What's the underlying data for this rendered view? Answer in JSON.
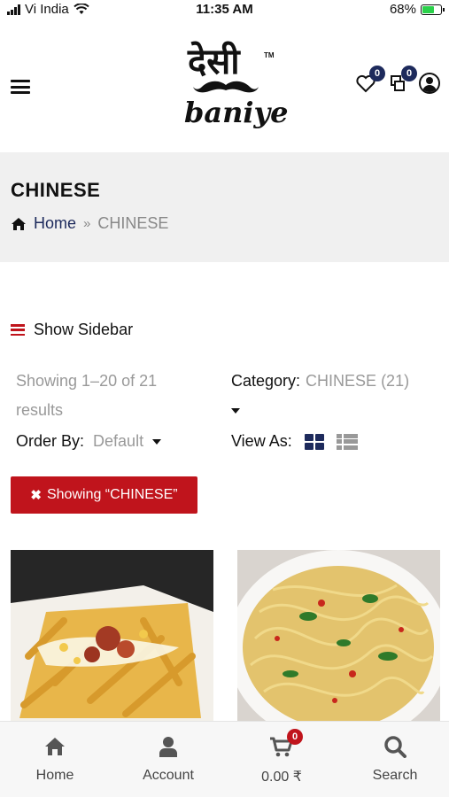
{
  "status_bar": {
    "carrier": "Vi India",
    "time": "11:35 AM",
    "battery": "68%",
    "battery_level": 0.68
  },
  "header": {
    "logo_top": "देसी",
    "logo_tm": "TM",
    "logo_bottom": "baniye",
    "wishlist_count": "0",
    "compare_count": "0"
  },
  "breadcrumb": {
    "title": "CHINESE",
    "home": "Home",
    "separator": "»",
    "current": "CHINESE"
  },
  "sidebar_toggle": {
    "label": "Show Sidebar"
  },
  "filters": {
    "results_text": "Showing 1–20 of 21 results",
    "category_label": "Category:",
    "category_value": "CHINESE (21)",
    "order_label": "Order By:",
    "order_value": "Default",
    "view_label": "View As:",
    "active_filter": "Showing “CHINESE”"
  },
  "bottom_nav": {
    "home": "Home",
    "account": "Account",
    "cart": "0.00 ₹",
    "cart_count": "0",
    "search": "Search"
  },
  "colors": {
    "accent_red": "#c0141c",
    "navy": "#1d2a5c",
    "muted_gray": "#999999"
  }
}
